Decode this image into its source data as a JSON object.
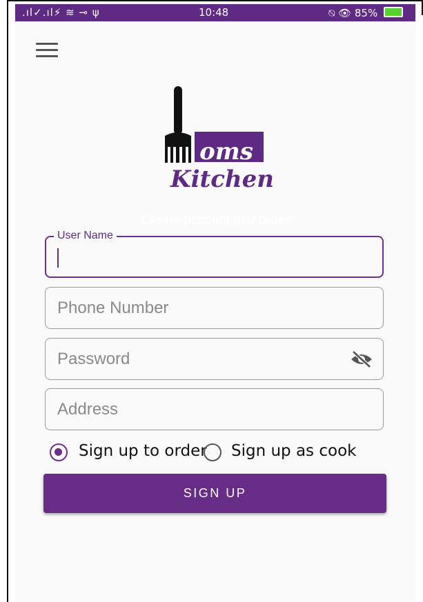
{
  "status_bar": {
    "signal_text": ".ıl✓.ıl⚡ ≋ ⊸ ψ",
    "time": "10:48",
    "battery_text": "⍉ 👁 85%"
  },
  "logo": {
    "line1": "oms",
    "line2": "Kitchen"
  },
  "form": {
    "subtitle": "Create account and order",
    "username_label": "User Name",
    "phone_placeholder": "Phone Number",
    "password_placeholder": "Password",
    "address_placeholder": "Address",
    "radio_order_label": "Sign up to order",
    "radio_cook_label": "Sign up as cook",
    "submit_label": "SIGN UP"
  },
  "colors": {
    "primary": "#5e2a84",
    "button": "#672c85"
  },
  "icons": [
    "menu-icon",
    "eye-off-icon",
    "fork-icon",
    "battery-icon"
  ]
}
